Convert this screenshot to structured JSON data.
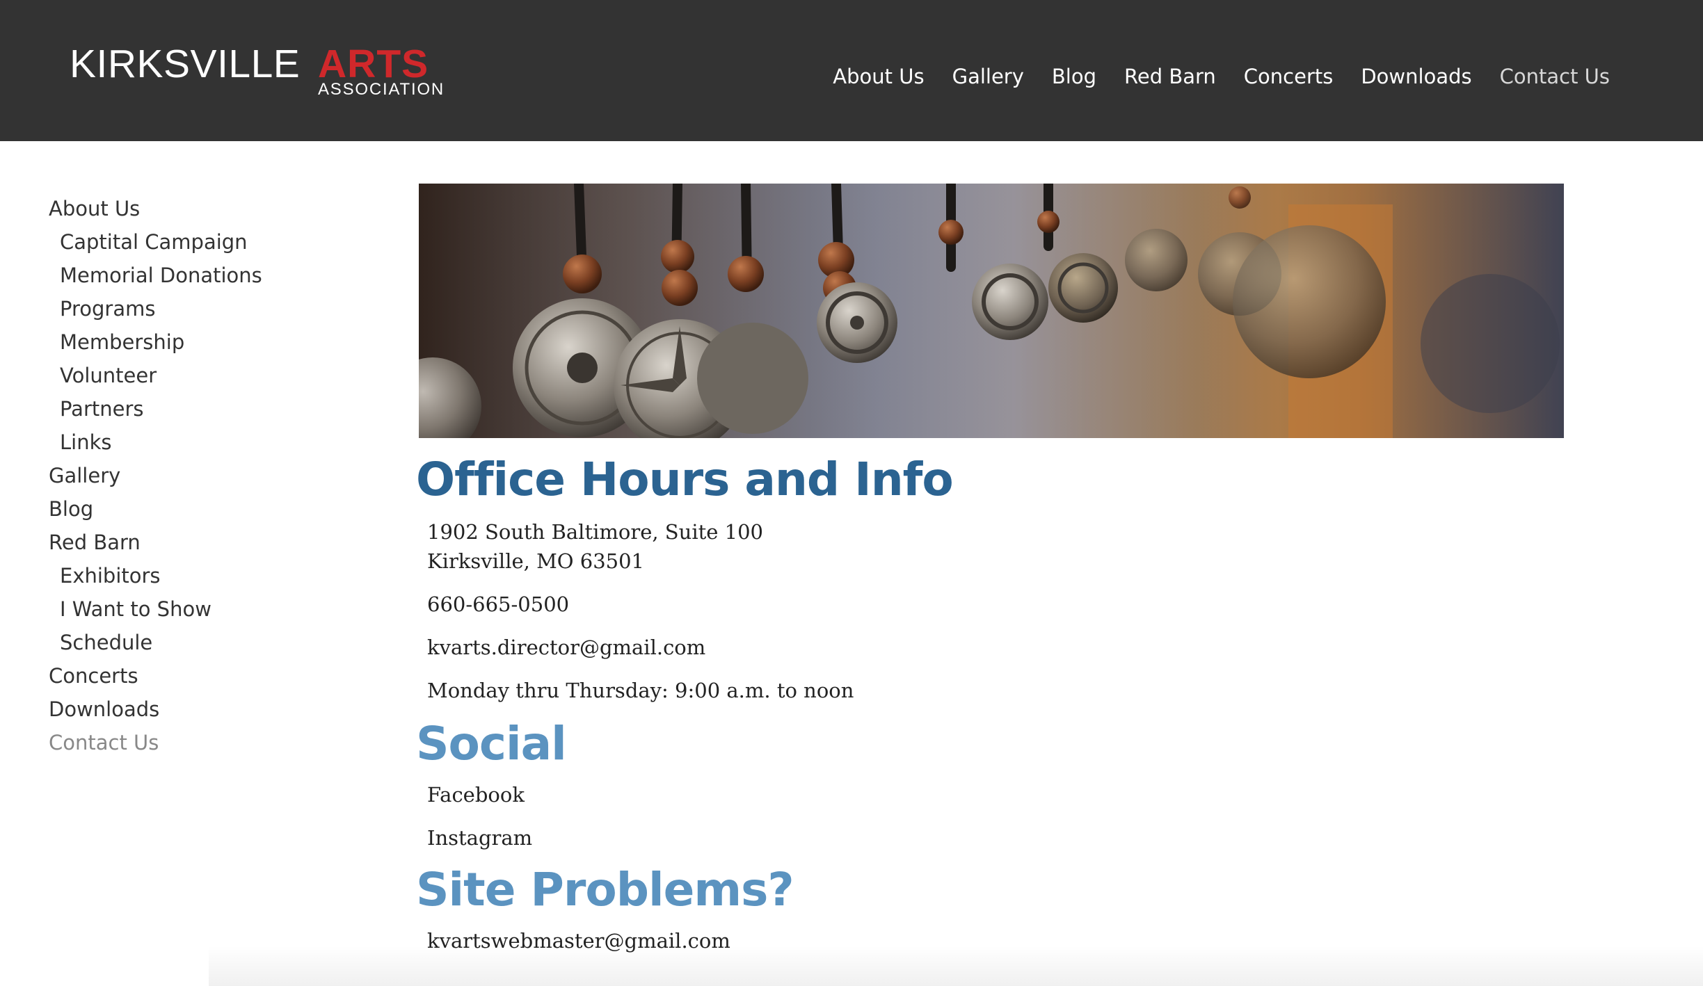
{
  "logo": {
    "name": "KIRKSVILLE",
    "arts": "ARTS",
    "association": "ASSOCIATION"
  },
  "top_nav": [
    {
      "label": "About Us"
    },
    {
      "label": "Gallery"
    },
    {
      "label": "Blog"
    },
    {
      "label": "Red Barn"
    },
    {
      "label": "Concerts"
    },
    {
      "label": "Downloads"
    },
    {
      "label": "Contact Us",
      "current": true
    }
  ],
  "sidebar": [
    {
      "label": "About Us",
      "level": 1
    },
    {
      "label": "Captital Campaign",
      "level": 2
    },
    {
      "label": "Memorial Donations",
      "level": 2
    },
    {
      "label": "Programs",
      "level": 2
    },
    {
      "label": "Membership",
      "level": 2
    },
    {
      "label": "Volunteer",
      "level": 2
    },
    {
      "label": "Partners",
      "level": 2
    },
    {
      "label": "Links",
      "level": 2
    },
    {
      "label": "Gallery",
      "level": 1
    },
    {
      "label": "Blog",
      "level": 1
    },
    {
      "label": "Red Barn",
      "level": 1
    },
    {
      "label": "Exhibitors",
      "level": 2
    },
    {
      "label": "I Want to Show",
      "level": 2
    },
    {
      "label": "Schedule",
      "level": 2
    },
    {
      "label": "Concerts",
      "level": 1
    },
    {
      "label": "Downloads",
      "level": 1
    },
    {
      "label": "Contact Us",
      "level": 1,
      "current": true
    }
  ],
  "office": {
    "heading": "Office Hours and Info",
    "address_line1": "1902 South Baltimore, Suite 100",
    "address_line2": "Kirksville, MO 63501",
    "phone": "660-665-0500",
    "email": "kvarts.director@gmail.com",
    "hours": "Monday thru Thursday: 9:00 a.m. to noon"
  },
  "social": {
    "heading": "Social",
    "facebook": "Facebook",
    "instagram": "Instagram"
  },
  "site_problems": {
    "heading": "Site Problems?",
    "email": "kvartswebmaster@gmail.com"
  },
  "colors": {
    "header_bg": "#333333",
    "logo_accent": "#d0282b",
    "heading_dark_blue": "#2b6391",
    "heading_light_blue": "#5b93c0"
  }
}
